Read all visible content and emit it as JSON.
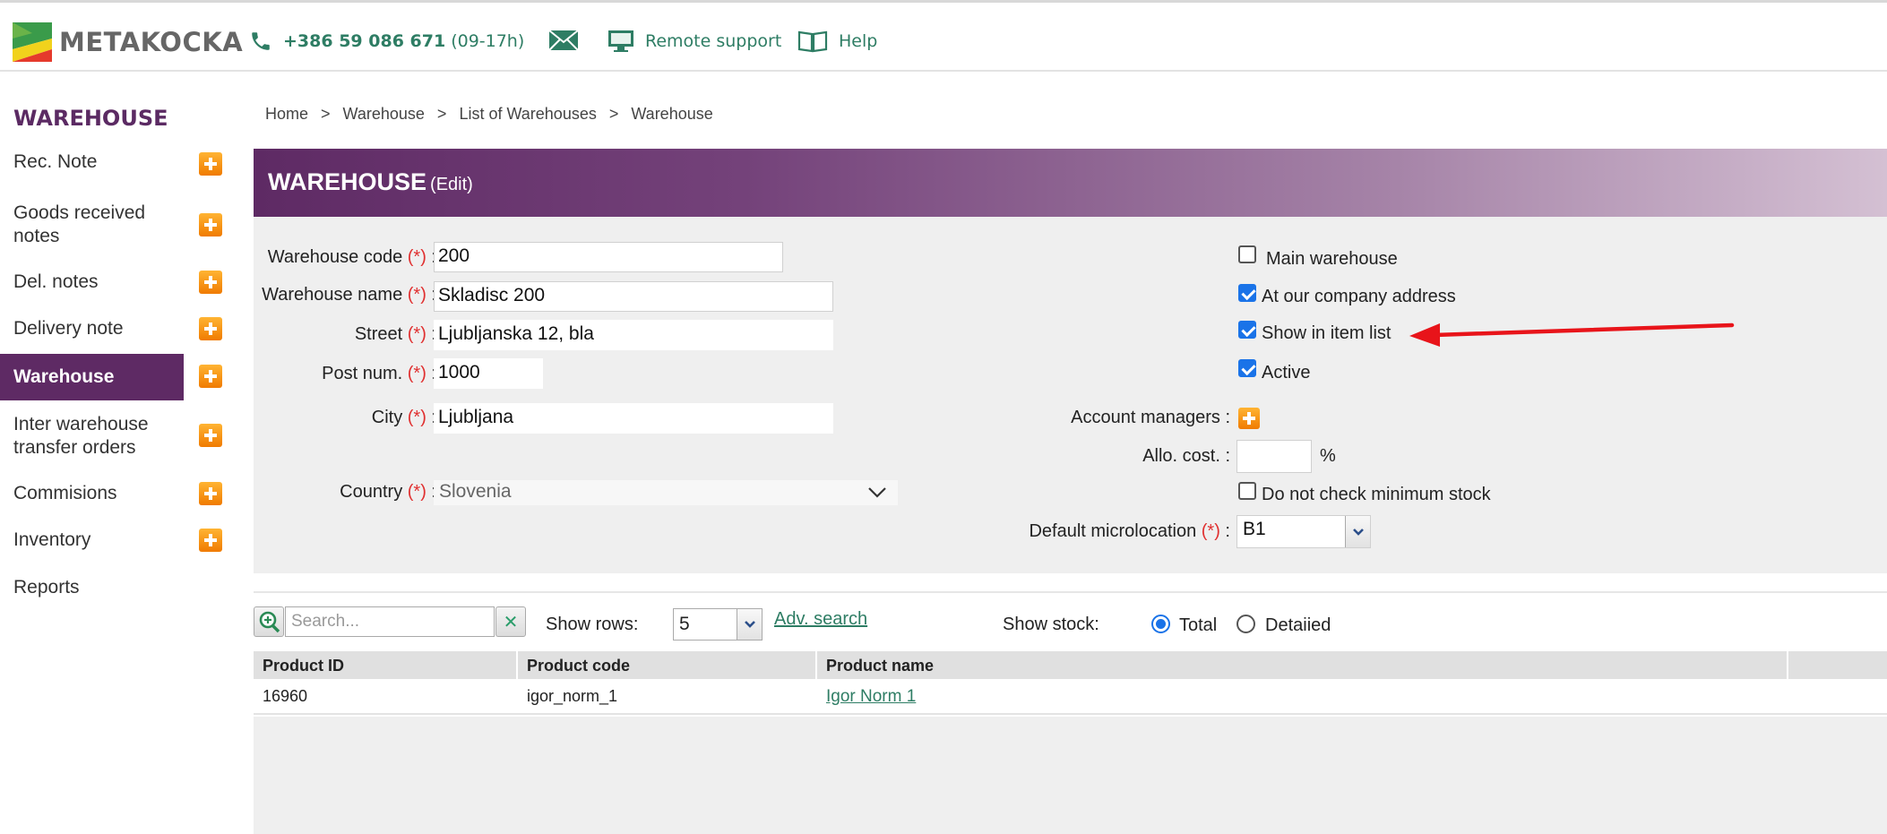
{
  "topbar": {
    "logo_text": "METAKOCKA",
    "phone_number": "+386 59 086 671",
    "phone_hours": "(09-17h)",
    "remote_support": "Remote support",
    "help": "Help"
  },
  "sidebar": {
    "title": "WAREHOUSE",
    "items": [
      {
        "label": "Rec. Note",
        "has_add": true
      },
      {
        "label": "Goods received notes",
        "has_add": true
      },
      {
        "label": "Del. notes",
        "has_add": true
      },
      {
        "label": "Delivery note",
        "has_add": true
      },
      {
        "label": "Warehouse",
        "has_add": true,
        "active": true
      },
      {
        "label": "Inter warehouse transfer orders",
        "has_add": true
      },
      {
        "label": "Commisions",
        "has_add": true
      },
      {
        "label": "Inventory",
        "has_add": true
      },
      {
        "label": "Reports",
        "has_add": false
      }
    ]
  },
  "breadcrumb": {
    "items": [
      "Home",
      "Warehouse",
      "List of Warehouses",
      "Warehouse"
    ],
    "separator": ">"
  },
  "banner": {
    "title": "WAREHOUSE",
    "subtitle": "(Edit)"
  },
  "form": {
    "required_marker": "(*)",
    "warehouse_code": {
      "label": "Warehouse code",
      "value": "200"
    },
    "warehouse_name": {
      "label": "Warehouse name",
      "value": "Skladisc 200"
    },
    "street": {
      "label": "Street",
      "value": "Ljubljanska 12, bla"
    },
    "post_num": {
      "label": "Post num.",
      "value": "1000"
    },
    "city": {
      "label": "City",
      "value": "Ljubljana"
    },
    "country": {
      "label": "Country",
      "value": "Slovenia"
    },
    "main_warehouse": {
      "label": "Main warehouse",
      "checked": false
    },
    "at_company_address": {
      "label": "At our company address",
      "checked": true
    },
    "show_in_item_list": {
      "label": "Show in item list",
      "checked": true
    },
    "active": {
      "label": "Active",
      "checked": true
    },
    "account_managers": {
      "label": "Account managers :"
    },
    "allo_cost": {
      "label": "Allo. cost. :",
      "value": "",
      "unit": "%"
    },
    "no_min_stock": {
      "label": "Do not check minimum stock",
      "checked": false
    },
    "default_microlocation": {
      "label": "Default microlocation",
      "value": "B1"
    }
  },
  "grid": {
    "search_placeholder": "Search...",
    "show_rows_label": "Show rows:",
    "show_rows_value": "5",
    "adv_search": "Adv. search",
    "show_stock_label": "Show stock:",
    "stock_total": "Total",
    "stock_detailed": "Detaiied",
    "stock_selected": "Total",
    "columns": [
      "Product ID",
      "Product code",
      "Product name"
    ],
    "rows": [
      {
        "product_id": "16960",
        "product_code": "igor_norm_1",
        "product_name": "Igor Norm 1"
      }
    ]
  },
  "colors": {
    "brand_purple": "#5e2a64",
    "accent_green": "#2e7d64",
    "add_orange": "#f07b00",
    "required_red": "#e03030",
    "annotation_red": "#e8141a"
  }
}
